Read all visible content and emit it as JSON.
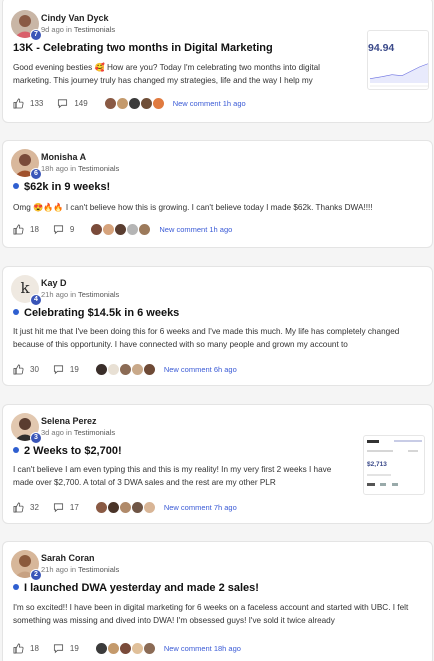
{
  "posts": [
    {
      "author": "Cindy Van Dyck",
      "level": "7",
      "time": "9d ago",
      "in_label": "in",
      "category": "Testimonials",
      "title": "13K - Celebrating two months in Digital Marketing",
      "body": "Good evening besties 🥰 How are you? Today I'm celebrating two months into digital marketing. This journey truly has changed my strategies, life and the way I help my",
      "likes": "133",
      "comments": "149",
      "new_comment": "New comment 1h ago",
      "thumb_text": "94.94",
      "faces": [
        "#8a5a44",
        "#c49a6c",
        "#3b3b3b",
        "#6f4e37",
        "#e07a3f"
      ]
    },
    {
      "author": "Monisha A",
      "level": "6",
      "time": "18h ago",
      "in_label": "in",
      "category": "Testimonials",
      "title": "$62k in 9 weeks!",
      "body": "Omg 😍🔥🔥 I can't believe how this is growing. I can't believe today I made $62k. Thanks DWA!!!!",
      "likes": "18",
      "comments": "9",
      "new_comment": "New comment 1h ago",
      "faces": [
        "#7a4b3a",
        "#d6a37c",
        "#5a3d30",
        "#b5b5b5",
        "#9c7a5b"
      ]
    },
    {
      "author": "Kay D",
      "level": "4",
      "time": "21h ago",
      "in_label": "in",
      "category": "Testimonials",
      "title": "Celebrating $14.5k in 6 weeks",
      "body": "It just hit me that I've been doing this for 6 weeks and I've made this much. My life has completely changed because of this opportunity. I have connected with so many people and grown my account to",
      "likes": "30",
      "comments": "19",
      "new_comment": "New comment 6h ago",
      "avatar_letter": "k",
      "faces": [
        "#3a2e2a",
        "#e8e0d4",
        "#8b6b55",
        "#c9a98a",
        "#6e4a36"
      ]
    },
    {
      "author": "Selena Perez",
      "level": "3",
      "time": "3d ago",
      "in_label": "in",
      "category": "Testimonials",
      "title": "2 Weeks to $2,700!",
      "body": "I can't believe I am even typing this and this is my reality! In my very first 2 weeks I have made over $2,700. A total of 3 DWA sales and the rest are my other PLR",
      "likes": "32",
      "comments": "17",
      "new_comment": "New comment 7h ago",
      "thumb_text": "$2,713",
      "faces": [
        "#8a5a44",
        "#4a3428",
        "#b08a6a",
        "#6f5545",
        "#d8b596"
      ]
    },
    {
      "author": "Sarah Coran",
      "level": "2",
      "time": "21h ago",
      "in_label": "in",
      "category": "Testimonials",
      "title": "I launched DWA yesterday and made 2 sales!",
      "body": "I'm so excited!! I have been in digital marketing for 6 weeks on a faceless account and started with UBC. I felt something was missing and dived into DWA! I'm obsessed guys! I've sold it twice already",
      "likes": "18",
      "comments": "19",
      "new_comment": "New comment 18h ago",
      "faces": [
        "#3b3b3b",
        "#c49a6c",
        "#7a4b3a",
        "#e0c09a",
        "#8b6b55"
      ]
    }
  ],
  "colors": {
    "accent": "#3b5bd6",
    "level_badge": "#3a55b8",
    "dot": "#2f5fd0"
  },
  "icons": {
    "like": "thumbs-up-icon",
    "comment": "comment-bubble-icon"
  }
}
